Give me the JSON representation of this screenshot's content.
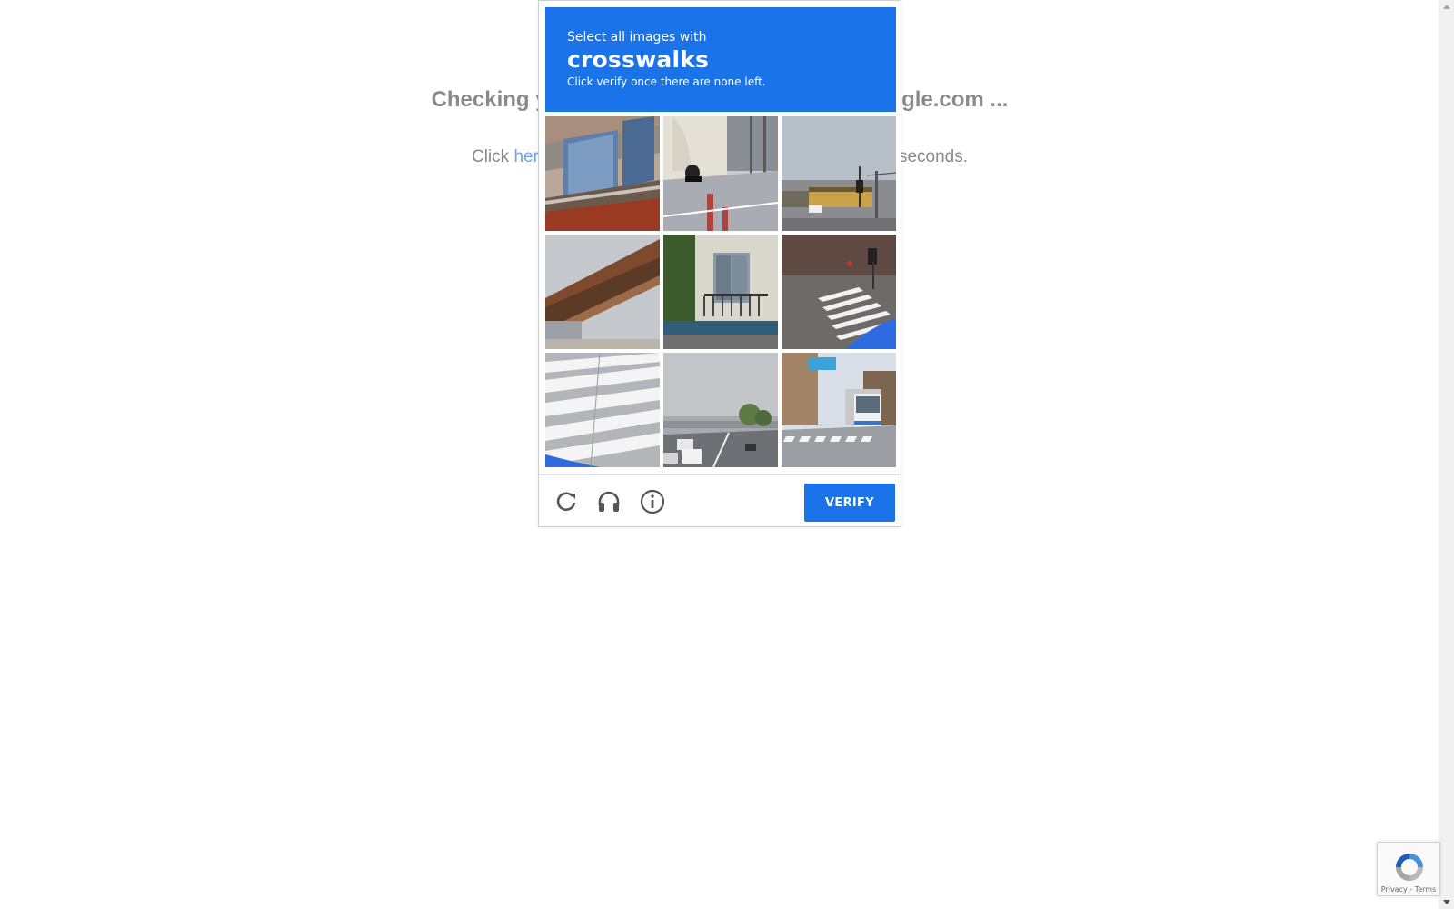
{
  "background": {
    "heading": "Checking your browser before accessing kaggle.com ...",
    "line_prefix": "Click ",
    "line_link": "here",
    "line_suffix": " if you are not automatically redirected after 5 seconds."
  },
  "captcha": {
    "instruction": "Select all images with",
    "target": "crosswalks",
    "hint": "Click verify once there are none left.",
    "tiles": [
      {
        "subject": "bridge-railing"
      },
      {
        "subject": "motorcycle-street"
      },
      {
        "subject": "traffic-light-intersection"
      },
      {
        "subject": "steel-bridge-underside"
      },
      {
        "subject": "building-balcony"
      },
      {
        "subject": "crosswalk-street"
      },
      {
        "subject": "crosswalk-closeup"
      },
      {
        "subject": "highway-overpass"
      },
      {
        "subject": "bus-crosswalk"
      }
    ],
    "footer": {
      "reload_icon": "reload-icon",
      "audio_icon": "headphones-icon",
      "info_icon": "info-icon",
      "verify_label": "VERIFY"
    },
    "colors": {
      "accent": "#1a73e8"
    }
  },
  "badge": {
    "links": "Privacy - Terms"
  }
}
